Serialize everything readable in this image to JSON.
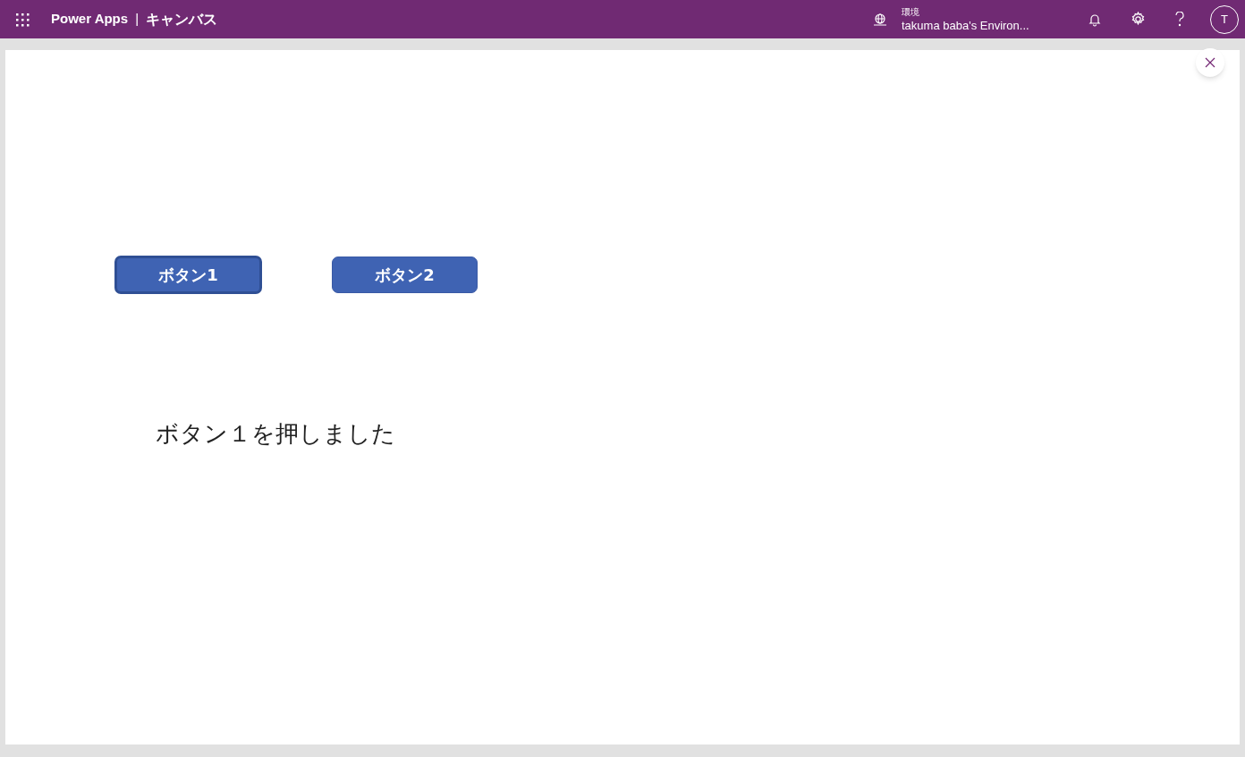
{
  "header": {
    "app_name": "Power Apps",
    "separator": "|",
    "app_kind": "キャンバス",
    "environment_label": "環境",
    "environment_name": "takuma baba's Environ...",
    "avatar_initial": "T"
  },
  "canvas": {
    "buttons": [
      {
        "label": "ボタン1",
        "focused": true
      },
      {
        "label": "ボタン2",
        "focused": false
      }
    ],
    "message": "ボタン１を押しました"
  }
}
